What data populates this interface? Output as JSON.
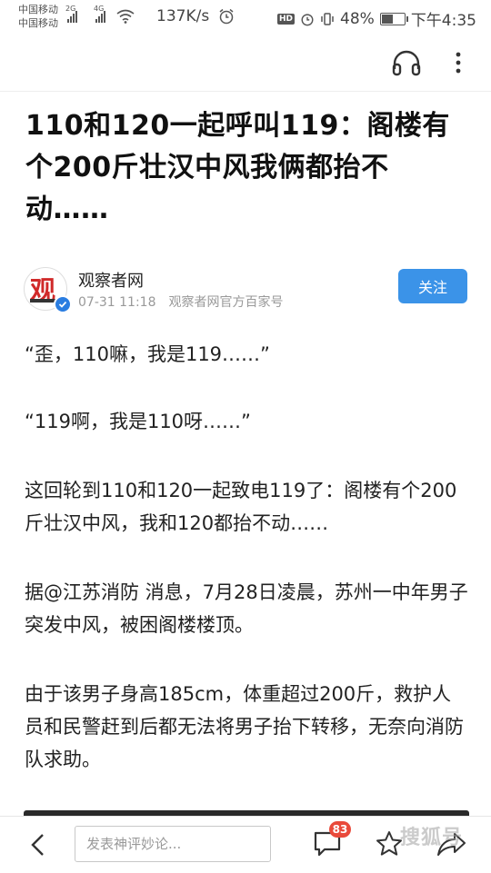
{
  "status_bar": {
    "carrier_1": "中国移动",
    "carrier_2": "中国移动",
    "net_1": "2G",
    "net_2": "4G",
    "net_speed": "137K/s",
    "hd_label": "HD",
    "battery": "48%",
    "battery_level": 0.48,
    "time": "下午4:35"
  },
  "article": {
    "title": "110和120一起呼叫119：阁楼有个200斤壮汉中风我俩都抬不动……",
    "author": {
      "avatar_char": "观",
      "name": "观察者网",
      "date": "07-31 11:18",
      "source": "观察者网官方百家号",
      "follow_label": "关注"
    },
    "paragraphs": [
      "“歪，110嘛，我是119……”",
      "“119啊，我是110呀……”",
      "这回轮到110和120一起致电119了：阁楼有个200斤壮汉中风，我和120都抬不动……",
      "据@江苏消防 消息，7月28日凌晨，苏州一中年男子突发中风，被困阁楼楼顶。",
      "由于该男子身高185cm，体重超过200斤，救护人员和民警赶到后都无法将男子抬下转移，无奈向消防队求助。"
    ]
  },
  "bottom_bar": {
    "comment_placeholder": "发表神评妙论...",
    "comment_count": "83",
    "watermark": "搜狐号"
  },
  "icons": {
    "headphones": "headphones-icon",
    "more": "more-vertical-icon",
    "back": "back-arrow-icon",
    "comment": "comment-icon",
    "star": "star-icon",
    "share": "share-icon"
  },
  "colors": {
    "accent": "#3b93e8",
    "badge": "#e94a3b",
    "verified": "#2a7de1",
    "logo_red": "#d02a2a"
  }
}
